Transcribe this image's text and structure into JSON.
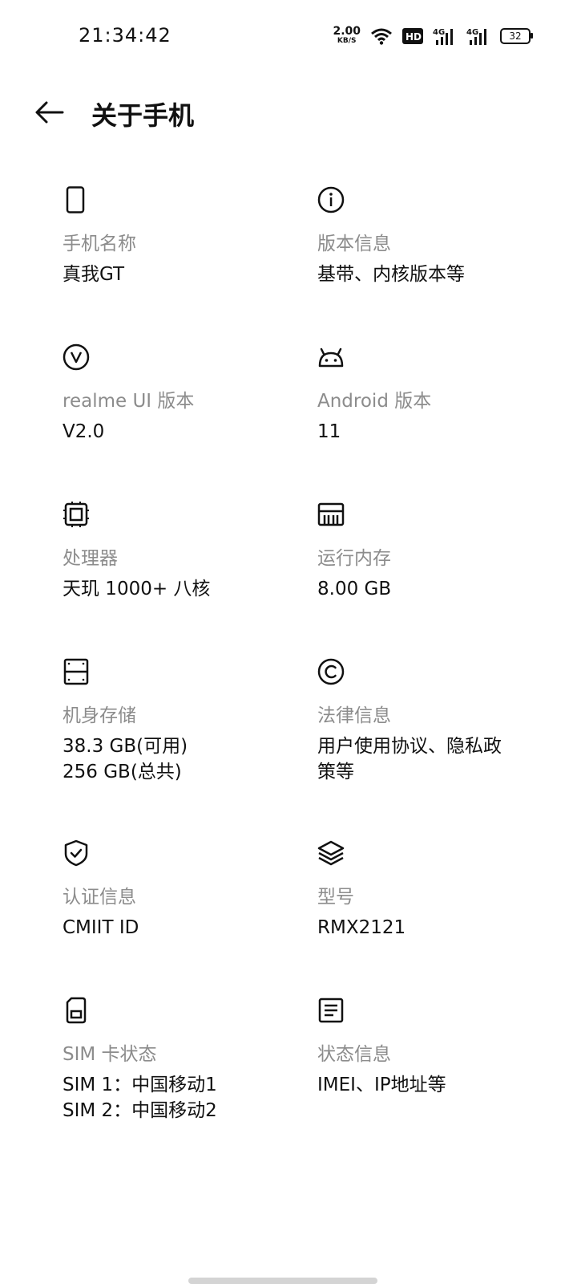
{
  "status_bar": {
    "time": "21:34:42",
    "net_speed_value": "2.00",
    "net_speed_unit": "KB/S",
    "hd_badge": "HD",
    "signal_1": "4G",
    "signal_2": "4G",
    "battery": "32",
    "icons": [
      "wifi-icon",
      "hd-voice-icon",
      "signal-icon",
      "signal-icon",
      "battery-icon"
    ]
  },
  "header": {
    "title": "关于手机",
    "back_icon": "back-arrow-icon"
  },
  "items": [
    {
      "icon": "phone-icon",
      "label": "手机名称",
      "value": [
        "真我GT"
      ]
    },
    {
      "icon": "info-icon",
      "label": "版本信息",
      "value": [
        "基带、内核版本等"
      ]
    },
    {
      "icon": "realme-v-icon",
      "label": "realme UI 版本",
      "value": [
        "V2.0"
      ]
    },
    {
      "icon": "android-icon",
      "label": "Android 版本",
      "value": [
        "11"
      ]
    },
    {
      "icon": "processor-icon",
      "label": "处理器",
      "value": [
        "天玑 1000+ 八核"
      ]
    },
    {
      "icon": "memory-icon",
      "label": "运行内存",
      "value": [
        "8.00 GB"
      ]
    },
    {
      "icon": "storage-icon",
      "label": "机身存储",
      "value": [
        "38.3 GB(可用)",
        "256 GB(总共)"
      ]
    },
    {
      "icon": "copyright-icon",
      "label": "法律信息",
      "value": [
        "用户使用协议、隐私政",
        "策等"
      ]
    },
    {
      "icon": "shield-check-icon",
      "label": "认证信息",
      "value": [
        "CMIIT ID"
      ]
    },
    {
      "icon": "layers-icon",
      "label": "型号",
      "value": [
        "RMX2121"
      ]
    },
    {
      "icon": "sim-card-icon",
      "label": "SIM 卡状态",
      "value": [
        "SIM 1：中国移动1",
        "SIM 2：中国移动2"
      ]
    },
    {
      "icon": "document-icon",
      "label": "状态信息",
      "value": [
        "IMEI、IP地址等"
      ]
    }
  ]
}
